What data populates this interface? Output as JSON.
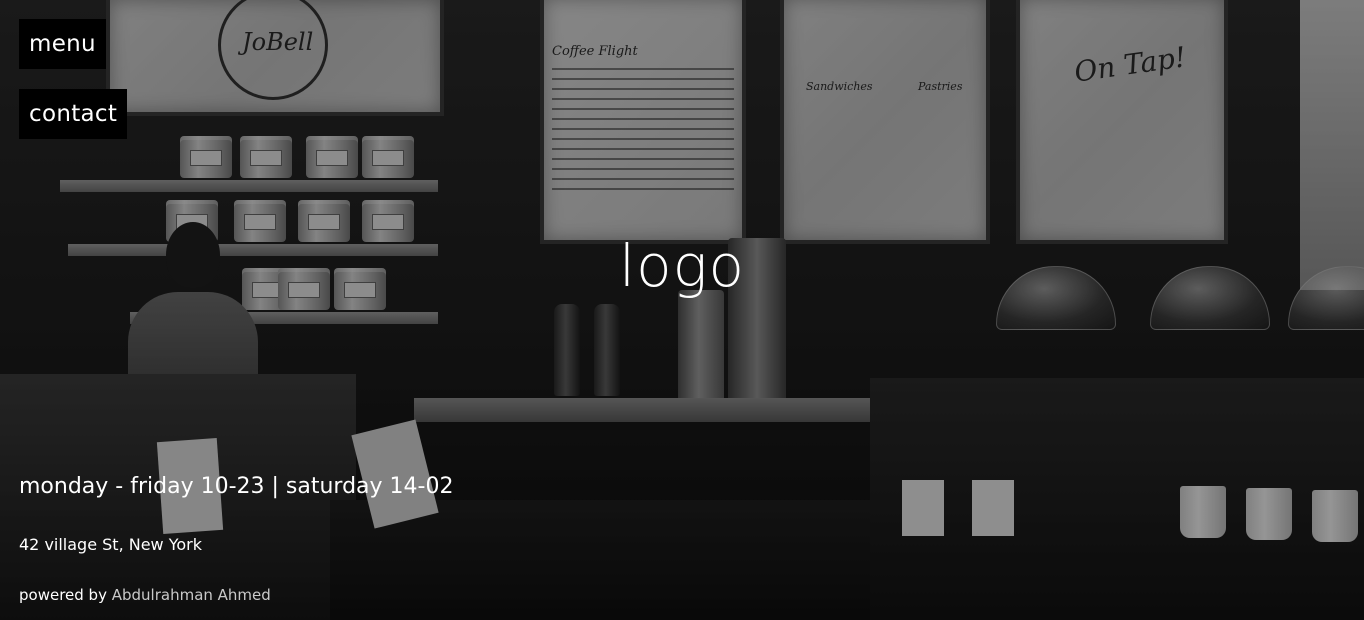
{
  "nav": {
    "menu_label": "menu",
    "contact_label": "contact"
  },
  "hero": {
    "logo_text": "logo",
    "hours": "monday - friday 10-23 | saturday 14-02",
    "address": "42 village St, New York"
  },
  "footer": {
    "powered_prefix": "powered by",
    "author_name": "Abdulrahman Ahmed"
  },
  "background_signs": {
    "left_sign": "JoBell",
    "menu_board_heading": "Coffee Flight",
    "middle_board_left": "Sandwiches",
    "middle_board_right": "Pastries",
    "right_board": "On Tap!"
  },
  "colors": {
    "nav_background": "#000000",
    "text": "#ffffff",
    "author_link": "#c9c9c9"
  }
}
